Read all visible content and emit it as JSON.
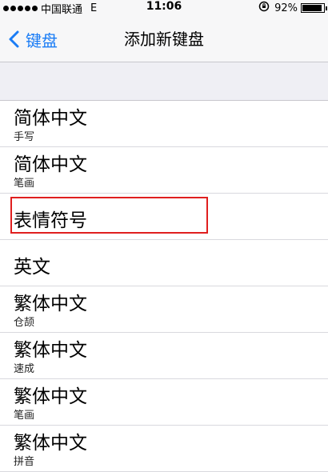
{
  "status_bar": {
    "carrier": "中国联通",
    "network": "E",
    "time": "11:06",
    "battery_percent": "92%",
    "battery_level": 0.92
  },
  "nav": {
    "back_label": "键盘",
    "title": "添加新键盘"
  },
  "keyboards": [
    {
      "title": "简体中文",
      "subtitle": "手写"
    },
    {
      "title": "简体中文",
      "subtitle": "笔画"
    },
    {
      "title": "表情符号",
      "subtitle": "",
      "highlighted": true
    },
    {
      "title": "英文",
      "subtitle": ""
    },
    {
      "title": "繁体中文",
      "subtitle": "仓颉"
    },
    {
      "title": "繁体中文",
      "subtitle": "速成"
    },
    {
      "title": "繁体中文",
      "subtitle": "笔画"
    },
    {
      "title": "繁体中文",
      "subtitle": "拼音"
    }
  ],
  "colors": {
    "accent": "#1a7cf5",
    "highlight_border": "#e01f1f",
    "group_background": "#efeff4"
  },
  "icons": {
    "back": "chevron-left-icon",
    "rotation_lock": "rotation-lock-icon",
    "battery": "battery-icon",
    "signal": "signal-dots-icon"
  }
}
